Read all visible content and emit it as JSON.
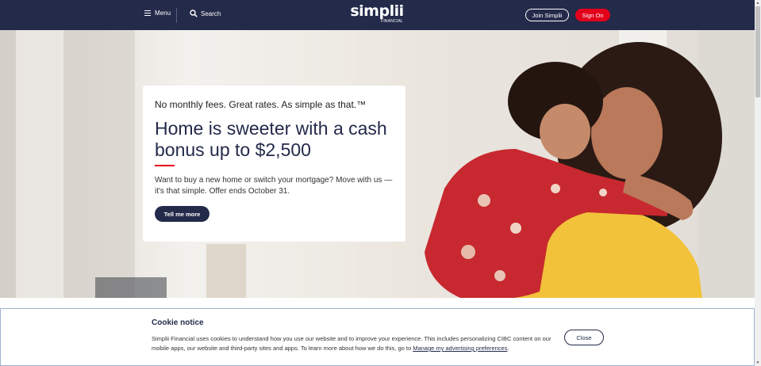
{
  "header": {
    "menu_label": "Menu",
    "search_label": "Search",
    "logo_main": "simplii",
    "logo_sub": "FINANCIAL",
    "join_label": "Join Simplii",
    "signon_label": "Sign On"
  },
  "hero": {
    "tagline": "No monthly fees. Great rates. As simple as that.™",
    "title": "Home is sweeter with a cash bonus up to $2,500",
    "body": "Want to buy a new home or switch your mortgage? Move with us — it's that simple. Offer ends October 31.",
    "cta_label": "Tell me more"
  },
  "cookie": {
    "title": "Cookie notice",
    "text": "Simplii Financial uses cookies to understand how you use our website and to improve your experience. This includes personalizing CIBC content on our mobile apps, our website and third-party sites and apps. To learn more about how we do this, go to ",
    "link_label": "Manage my advertising preferences",
    "text_end": ".",
    "close_label": "Close"
  },
  "colors": {
    "navy": "#232a4a",
    "brand_red": "#e3001b"
  },
  "icons": {
    "menu": "hamburger-icon",
    "search": "search-icon"
  }
}
